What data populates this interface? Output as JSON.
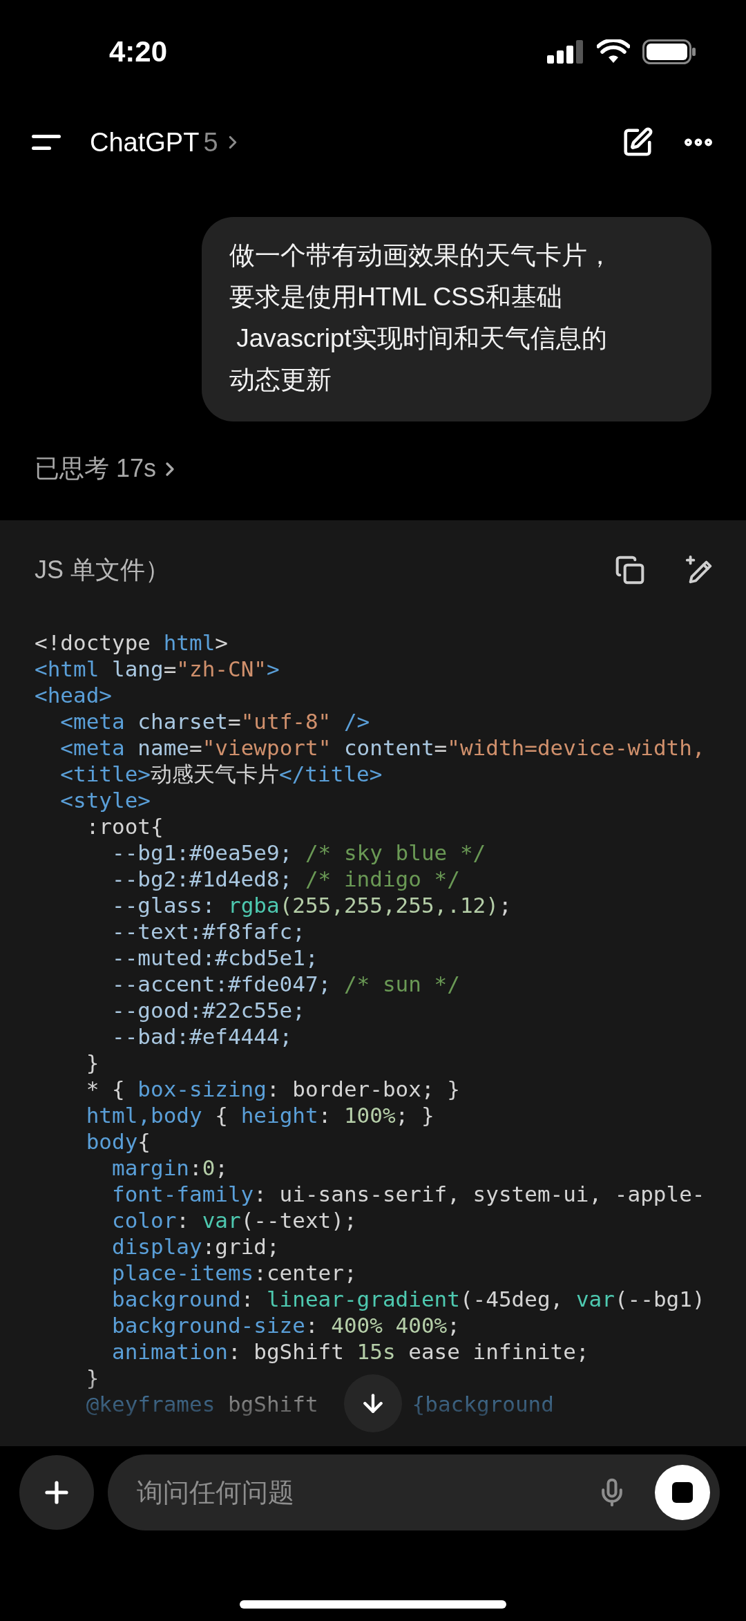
{
  "status_bar": {
    "time": "4:20"
  },
  "header": {
    "title": "ChatGPT",
    "version": "5"
  },
  "user_message": {
    "lines": [
      "做一个带有动画效果的天气卡片，",
      "要求是使用HTML CSS和基础",
      " Javascript实现时间和天气信息的",
      "动态更新"
    ]
  },
  "thinking": {
    "label": "已思考 17s"
  },
  "code_block": {
    "title": "JS 单文件）",
    "lines": [
      [
        {
          "kind": "plain",
          "text": "<!doctype "
        },
        {
          "kind": "tag",
          "text": "html"
        },
        {
          "kind": "plain",
          "text": ">"
        }
      ],
      [
        {
          "kind": "tag",
          "text": "<html"
        },
        {
          "kind": "attr",
          "text": " lang"
        },
        {
          "kind": "plain",
          "text": "="
        },
        {
          "kind": "string",
          "text": "\"zh-CN\""
        },
        {
          "kind": "tag",
          "text": ">"
        }
      ],
      [
        {
          "kind": "tag",
          "text": "<head>"
        }
      ],
      [
        {
          "kind": "tag",
          "text": "  <meta"
        },
        {
          "kind": "attr",
          "text": " charset"
        },
        {
          "kind": "plain",
          "text": "="
        },
        {
          "kind": "string",
          "text": "\"utf-8\""
        },
        {
          "kind": "tag",
          "text": " />"
        }
      ],
      [
        {
          "kind": "tag",
          "text": "  <meta"
        },
        {
          "kind": "attr",
          "text": " name"
        },
        {
          "kind": "plain",
          "text": "="
        },
        {
          "kind": "string",
          "text": "\"viewport\""
        },
        {
          "kind": "attr",
          "text": " content"
        },
        {
          "kind": "plain",
          "text": "="
        },
        {
          "kind": "string",
          "text": "\"width=device-width,"
        }
      ],
      [
        {
          "kind": "tag",
          "text": "  <title>"
        },
        {
          "kind": "plain",
          "text": "动感天气卡片"
        },
        {
          "kind": "tag",
          "text": "</title>"
        }
      ],
      [
        {
          "kind": "tag",
          "text": "  <style>"
        }
      ],
      [
        {
          "kind": "plain",
          "text": "    :root{"
        }
      ],
      [
        {
          "kind": "attr",
          "text": "      --bg1:#0ea5e9; "
        },
        {
          "kind": "comment",
          "text": "/* sky blue */"
        }
      ],
      [
        {
          "kind": "attr",
          "text": "      --bg2:#1d4ed8; "
        },
        {
          "kind": "comment",
          "text": "/* indigo */"
        }
      ],
      [
        {
          "kind": "attr",
          "text": "      --glass: "
        },
        {
          "kind": "func",
          "text": "rgba"
        },
        {
          "kind": "number",
          "text": "(255,255,255,.12)"
        },
        {
          "kind": "plain",
          "text": ";"
        }
      ],
      [
        {
          "kind": "attr",
          "text": "      --text:#f8fafc;"
        }
      ],
      [
        {
          "kind": "attr",
          "text": "      --muted:#cbd5e1;"
        }
      ],
      [
        {
          "kind": "attr",
          "text": "      --accent:#fde047; "
        },
        {
          "kind": "comment",
          "text": "/* sun */"
        }
      ],
      [
        {
          "kind": "attr",
          "text": "      --good:#22c55e;"
        }
      ],
      [
        {
          "kind": "attr",
          "text": "      --bad:#ef4444;"
        }
      ],
      [
        {
          "kind": "plain",
          "text": "    }"
        }
      ],
      [
        {
          "kind": "plain",
          "text": "    * { "
        },
        {
          "kind": "tag",
          "text": "box-sizing"
        },
        {
          "kind": "plain",
          "text": ": border-box; }"
        }
      ],
      [
        {
          "kind": "tag",
          "text": "    html,body"
        },
        {
          "kind": "plain",
          "text": " { "
        },
        {
          "kind": "tag",
          "text": "height"
        },
        {
          "kind": "plain",
          "text": ": "
        },
        {
          "kind": "number",
          "text": "100%"
        },
        {
          "kind": "plain",
          "text": "; }"
        }
      ],
      [
        {
          "kind": "tag",
          "text": "    body"
        },
        {
          "kind": "plain",
          "text": "{"
        }
      ],
      [
        {
          "kind": "tag",
          "text": "      margin"
        },
        {
          "kind": "plain",
          "text": ":"
        },
        {
          "kind": "number",
          "text": "0"
        },
        {
          "kind": "plain",
          "text": ";"
        }
      ],
      [
        {
          "kind": "tag",
          "text": "      font-family"
        },
        {
          "kind": "plain",
          "text": ": ui-sans-serif, system-ui, -apple-"
        }
      ],
      [
        {
          "kind": "tag",
          "text": "      color"
        },
        {
          "kind": "plain",
          "text": ": "
        },
        {
          "kind": "func",
          "text": "var"
        },
        {
          "kind": "plain",
          "text": "(--text);"
        }
      ],
      [
        {
          "kind": "tag",
          "text": "      display"
        },
        {
          "kind": "plain",
          "text": ":grid;"
        }
      ],
      [
        {
          "kind": "tag",
          "text": "      place-items"
        },
        {
          "kind": "plain",
          "text": ":center;"
        }
      ],
      [
        {
          "kind": "tag",
          "text": "      background"
        },
        {
          "kind": "plain",
          "text": ": "
        },
        {
          "kind": "func",
          "text": "linear-gradient"
        },
        {
          "kind": "plain",
          "text": "(-45deg, "
        },
        {
          "kind": "func",
          "text": "var"
        },
        {
          "kind": "plain",
          "text": "(--bg1)"
        }
      ],
      [
        {
          "kind": "tag",
          "text": "      background-size"
        },
        {
          "kind": "plain",
          "text": ": "
        },
        {
          "kind": "number",
          "text": "400% 400%"
        },
        {
          "kind": "plain",
          "text": ";"
        }
      ],
      [
        {
          "kind": "tag",
          "text": "      animation"
        },
        {
          "kind": "plain",
          "text": ": bgShift "
        },
        {
          "kind": "number",
          "text": "15s"
        },
        {
          "kind": "plain",
          "text": " ease infinite;"
        }
      ],
      [
        {
          "kind": "plain",
          "text": "    }"
        }
      ],
      {
        "parts": [
          [
            {
              "kind": "tag",
              "text": "    @keyframes"
            },
            {
              "kind": "plain",
              "text": " bgShift"
            }
          ],
          [
            {
              "kind": "tag",
              "text": "{background"
            }
          ]
        ]
      }
    ]
  },
  "composer": {
    "placeholder": "询问任何问题"
  }
}
